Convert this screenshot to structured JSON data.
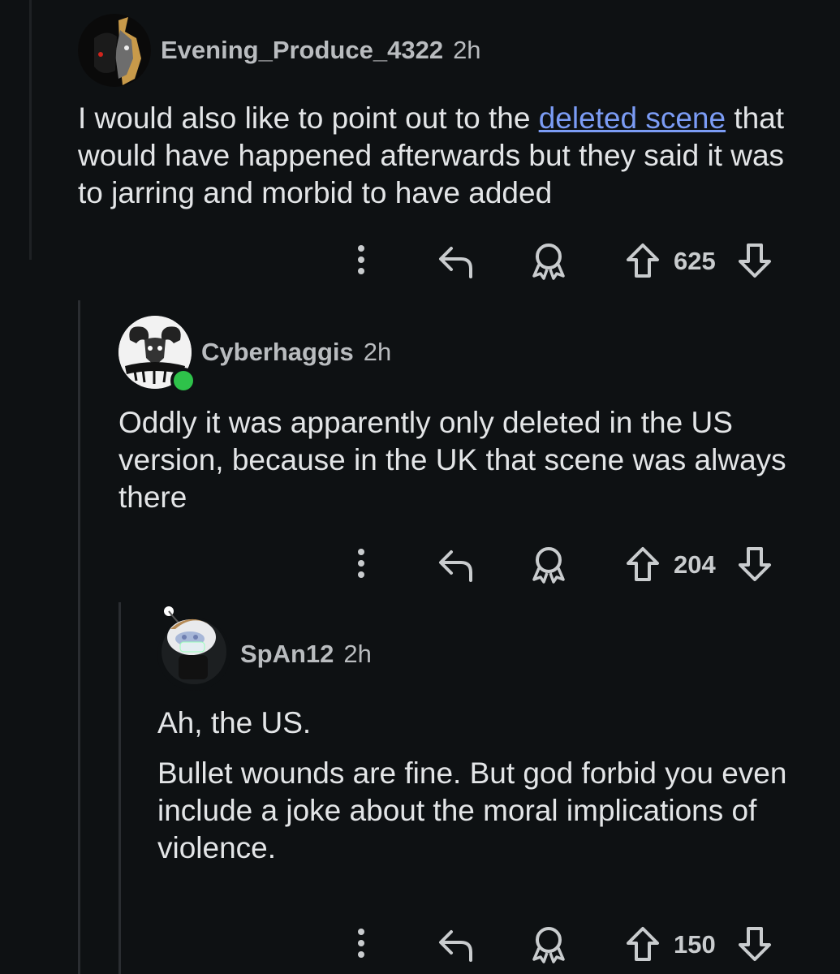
{
  "comments": [
    {
      "username": "Evening_Produce_4322",
      "time": "2h",
      "body_before_link": "I would also like to point out to the ",
      "link_text": "deleted scene",
      "body_after_link": " that would have happened afterwards but they said it was to jarring and morbid to have added",
      "votes": "625",
      "avatar_icon": "dark-creature-avatar"
    },
    {
      "username": "Cyberhaggis",
      "time": "2h",
      "body": "Oddly it was apparently only deleted in the US version, because in the UK that scene was always there",
      "votes": "204",
      "online": true,
      "avatar_icon": "ram-skull-avatar"
    },
    {
      "username": "SpAn12",
      "time": "2h",
      "body_para1": "Ah, the US.",
      "body_para2": "Bullet wounds are fine. But god forbid you even include a joke about the moral implications of violence.",
      "votes": "150",
      "avatar_icon": "snoo-mask-avatar"
    }
  ],
  "icons": {
    "more": "more-vertical-icon",
    "reply": "reply-icon",
    "award": "award-icon",
    "upvote": "upvote-icon",
    "downvote": "downvote-icon"
  },
  "colors": {
    "background": "#0e1113",
    "link": "#7b9cf5",
    "online": "#2ec24a",
    "text": "#e3e5e7"
  }
}
